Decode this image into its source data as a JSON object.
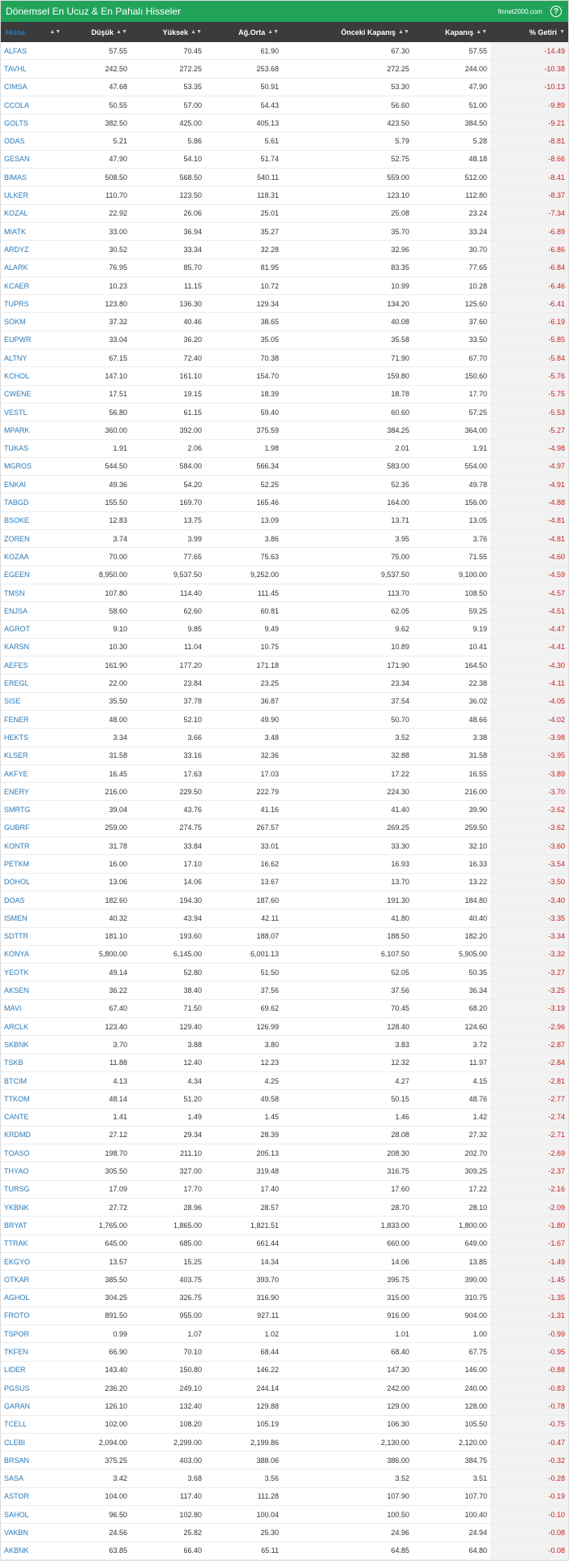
{
  "header": {
    "title": "Dönemsel En Ucuz & En Pahalı Hisseler",
    "brand": "finnet2000.com",
    "help": "?"
  },
  "columns": {
    "symbol": "Hisse",
    "low": "Düşük",
    "high": "Yüksek",
    "avg": "Ağ.Orta",
    "prev": "Önceki Kapanış",
    "close": "Kapanış",
    "ret": "% Getiri"
  },
  "colors": {
    "accent": "#21a45a",
    "header_bg": "#3b3b3b",
    "link": "#2a7ab8",
    "negative": "#cc2020"
  },
  "rows": [
    [
      "ALFAS",
      "57.55",
      "70.45",
      "61.90",
      "67.30",
      "57.55",
      "-14.49"
    ],
    [
      "TAVHL",
      "242.50",
      "272.25",
      "253.68",
      "272.25",
      "244.00",
      "-10.38"
    ],
    [
      "CIMSA",
      "47.68",
      "53.35",
      "50.91",
      "53.30",
      "47.90",
      "-10.13"
    ],
    [
      "CCOLA",
      "50.55",
      "57.00",
      "54.43",
      "56.60",
      "51.00",
      "-9.89"
    ],
    [
      "GOLTS",
      "382.50",
      "425.00",
      "405.13",
      "423.50",
      "384.50",
      "-9.21"
    ],
    [
      "ODAS",
      "5.21",
      "5.86",
      "5.61",
      "5.79",
      "5.28",
      "-8.81"
    ],
    [
      "GESAN",
      "47.90",
      "54.10",
      "51.74",
      "52.75",
      "48.18",
      "-8.66"
    ],
    [
      "BIMAS",
      "508.50",
      "568.50",
      "540.11",
      "559.00",
      "512.00",
      "-8.41"
    ],
    [
      "ULKER",
      "110.70",
      "123.50",
      "118.31",
      "123.10",
      "112.80",
      "-8.37"
    ],
    [
      "KOZAL",
      "22.92",
      "26.06",
      "25.01",
      "25.08",
      "23.24",
      "-7.34"
    ],
    [
      "MIATK",
      "33.00",
      "36.94",
      "35.27",
      "35.70",
      "33.24",
      "-6.89"
    ],
    [
      "ARDYZ",
      "30.52",
      "33.34",
      "32.28",
      "32.96",
      "30.70",
      "-6.86"
    ],
    [
      "ALARK",
      "76.95",
      "85.70",
      "81.95",
      "83.35",
      "77.65",
      "-6.84"
    ],
    [
      "KCAER",
      "10.23",
      "11.15",
      "10.72",
      "10.99",
      "10.28",
      "-6.46"
    ],
    [
      "TUPRS",
      "123.80",
      "136.30",
      "129.34",
      "134.20",
      "125.60",
      "-6.41"
    ],
    [
      "SOKM",
      "37.32",
      "40.46",
      "38.65",
      "40.08",
      "37.60",
      "-6.19"
    ],
    [
      "EUPWR",
      "33.04",
      "36.20",
      "35.05",
      "35.58",
      "33.50",
      "-5.85"
    ],
    [
      "ALTNY",
      "67.15",
      "72.40",
      "70.38",
      "71.90",
      "67.70",
      "-5.84"
    ],
    [
      "KCHOL",
      "147.10",
      "161.10",
      "154.70",
      "159.80",
      "150.60",
      "-5.76"
    ],
    [
      "CWENE",
      "17.51",
      "19.15",
      "18.39",
      "18.78",
      "17.70",
      "-5.75"
    ],
    [
      "VESTL",
      "56.80",
      "61.15",
      "59.40",
      "60.60",
      "57.25",
      "-5.53"
    ],
    [
      "MPARK",
      "360.00",
      "392.00",
      "375.59",
      "384.25",
      "364.00",
      "-5.27"
    ],
    [
      "TUKAS",
      "1.91",
      "2.06",
      "1.98",
      "2.01",
      "1.91",
      "-4.98"
    ],
    [
      "MGROS",
      "544.50",
      "584.00",
      "566.34",
      "583.00",
      "554.00",
      "-4.97"
    ],
    [
      "ENKAI",
      "49.36",
      "54.20",
      "52.25",
      "52.35",
      "49.78",
      "-4.91"
    ],
    [
      "TABGD",
      "155.50",
      "169.70",
      "165.46",
      "164.00",
      "156.00",
      "-4.88"
    ],
    [
      "BSOKE",
      "12.83",
      "13.75",
      "13.09",
      "13.71",
      "13.05",
      "-4.81"
    ],
    [
      "ZOREN",
      "3.74",
      "3.99",
      "3.86",
      "3.95",
      "3.76",
      "-4.81"
    ],
    [
      "KOZAA",
      "70.00",
      "77.65",
      "75.63",
      "75.00",
      "71.55",
      "-4.60"
    ],
    [
      "EGEEN",
      "8,950.00",
      "9,537.50",
      "9,252.00",
      "9,537.50",
      "9,100.00",
      "-4.59"
    ],
    [
      "TMSN",
      "107.80",
      "114.40",
      "111.45",
      "113.70",
      "108.50",
      "-4.57"
    ],
    [
      "ENJSA",
      "58.60",
      "62.60",
      "60.81",
      "62.05",
      "59.25",
      "-4.51"
    ],
    [
      "AGROT",
      "9.10",
      "9.85",
      "9.49",
      "9.62",
      "9.19",
      "-4.47"
    ],
    [
      "KARSN",
      "10.30",
      "11.04",
      "10.75",
      "10.89",
      "10.41",
      "-4.41"
    ],
    [
      "AEFES",
      "161.90",
      "177.20",
      "171.18",
      "171.90",
      "164.50",
      "-4.30"
    ],
    [
      "EREGL",
      "22.00",
      "23.84",
      "23.25",
      "23.34",
      "22.38",
      "-4.11"
    ],
    [
      "SISE",
      "35.50",
      "37.78",
      "36.87",
      "37.54",
      "36.02",
      "-4.05"
    ],
    [
      "FENER",
      "48.00",
      "52.10",
      "49.90",
      "50.70",
      "48.66",
      "-4.02"
    ],
    [
      "HEKTS",
      "3.34",
      "3.66",
      "3.48",
      "3.52",
      "3.38",
      "-3.98"
    ],
    [
      "KLSER",
      "31.58",
      "33.16",
      "32.36",
      "32.88",
      "31.58",
      "-3.95"
    ],
    [
      "AKFYE",
      "16.45",
      "17.63",
      "17.03",
      "17.22",
      "16.55",
      "-3.89"
    ],
    [
      "ENERY",
      "216.00",
      "229.50",
      "222.79",
      "224.30",
      "216.00",
      "-3.70"
    ],
    [
      "SMRTG",
      "39.04",
      "43.76",
      "41.16",
      "41.40",
      "39.90",
      "-3.62"
    ],
    [
      "GUBRF",
      "259.00",
      "274.75",
      "267.57",
      "269.25",
      "259.50",
      "-3.62"
    ],
    [
      "KONTR",
      "31.78",
      "33.84",
      "33.01",
      "33.30",
      "32.10",
      "-3.60"
    ],
    [
      "PETKM",
      "16.00",
      "17.10",
      "16.62",
      "16.93",
      "16.33",
      "-3.54"
    ],
    [
      "DOHOL",
      "13.06",
      "14.06",
      "13.67",
      "13.70",
      "13.22",
      "-3.50"
    ],
    [
      "DOAS",
      "182.60",
      "194.30",
      "187.60",
      "191.30",
      "184.80",
      "-3.40"
    ],
    [
      "ISMEN",
      "40.32",
      "43.94",
      "42.11",
      "41.80",
      "40.40",
      "-3.35"
    ],
    [
      "SDTTR",
      "181.10",
      "193.60",
      "188.07",
      "188.50",
      "182.20",
      "-3.34"
    ],
    [
      "KONYA",
      "5,800.00",
      "6,145.00",
      "6,001.13",
      "6,107.50",
      "5,905.00",
      "-3.32"
    ],
    [
      "YEOTK",
      "49.14",
      "52.80",
      "51.50",
      "52.05",
      "50.35",
      "-3.27"
    ],
    [
      "AKSEN",
      "36.22",
      "38.40",
      "37.56",
      "37.56",
      "36.34",
      "-3.25"
    ],
    [
      "MAVI",
      "67.40",
      "71.50",
      "69.62",
      "70.45",
      "68.20",
      "-3.19"
    ],
    [
      "ARCLK",
      "123.40",
      "129.40",
      "126.99",
      "128.40",
      "124.60",
      "-2.96"
    ],
    [
      "SKBNK",
      "3.70",
      "3.88",
      "3.80",
      "3.83",
      "3.72",
      "-2.87"
    ],
    [
      "TSKB",
      "11.88",
      "12.40",
      "12.23",
      "12.32",
      "11.97",
      "-2.84"
    ],
    [
      "BTCIM",
      "4.13",
      "4.34",
      "4.25",
      "4.27",
      "4.15",
      "-2.81"
    ],
    [
      "TTKOM",
      "48.14",
      "51.20",
      "49.58",
      "50.15",
      "48.76",
      "-2.77"
    ],
    [
      "CANTE",
      "1.41",
      "1.49",
      "1.45",
      "1.46",
      "1.42",
      "-2.74"
    ],
    [
      "KRDMD",
      "27.12",
      "29.34",
      "28.39",
      "28.08",
      "27.32",
      "-2.71"
    ],
    [
      "TOASO",
      "198.70",
      "211.10",
      "205.13",
      "208.30",
      "202.70",
      "-2.69"
    ],
    [
      "THYAO",
      "305.50",
      "327.00",
      "319.48",
      "316.75",
      "309.25",
      "-2.37"
    ],
    [
      "TURSG",
      "17.09",
      "17.70",
      "17.40",
      "17.60",
      "17.22",
      "-2.16"
    ],
    [
      "YKBNK",
      "27.72",
      "28.96",
      "28.57",
      "28.70",
      "28.10",
      "-2.09"
    ],
    [
      "BRYAT",
      "1,765.00",
      "1,865.00",
      "1,821.51",
      "1,833.00",
      "1,800.00",
      "-1.80"
    ],
    [
      "TTRAK",
      "645.00",
      "685.00",
      "661.44",
      "660.00",
      "649.00",
      "-1.67"
    ],
    [
      "EKGYO",
      "13.57",
      "15.25",
      "14.34",
      "14.06",
      "13.85",
      "-1.49"
    ],
    [
      "OTKAR",
      "385.50",
      "403.75",
      "393.70",
      "395.75",
      "390.00",
      "-1.45"
    ],
    [
      "AGHOL",
      "304.25",
      "326.75",
      "316.90",
      "315.00",
      "310.75",
      "-1.35"
    ],
    [
      "FROTO",
      "891.50",
      "955.00",
      "927.11",
      "916.00",
      "904.00",
      "-1.31"
    ],
    [
      "TSPOR",
      "0.99",
      "1.07",
      "1.02",
      "1.01",
      "1.00",
      "-0.99"
    ],
    [
      "TKFEN",
      "66.90",
      "70.10",
      "68.44",
      "68.40",
      "67.75",
      "-0.95"
    ],
    [
      "LIDER",
      "143.40",
      "150.80",
      "146.22",
      "147.30",
      "146.00",
      "-0.88"
    ],
    [
      "PGSUS",
      "236.20",
      "249.10",
      "244.14",
      "242.00",
      "240.00",
      "-0.83"
    ],
    [
      "GARAN",
      "126.10",
      "132.40",
      "129.88",
      "129.00",
      "128.00",
      "-0.78"
    ],
    [
      "TCELL",
      "102.00",
      "108.20",
      "105.19",
      "106.30",
      "105.50",
      "-0.75"
    ],
    [
      "CLEBI",
      "2,094.00",
      "2,299.00",
      "2,199.86",
      "2,130.00",
      "2,120.00",
      "-0.47"
    ],
    [
      "BRSAN",
      "375.25",
      "403.00",
      "388.06",
      "386.00",
      "384.75",
      "-0.32"
    ],
    [
      "SASA",
      "3.42",
      "3.68",
      "3.56",
      "3.52",
      "3.51",
      "-0.28"
    ],
    [
      "ASTOR",
      "104.00",
      "117.40",
      "111.28",
      "107.90",
      "107.70",
      "-0.19"
    ],
    [
      "SAHOL",
      "96.50",
      "102.80",
      "100.04",
      "100.50",
      "100.40",
      "-0.10"
    ],
    [
      "VAKBN",
      "24.56",
      "25.82",
      "25.30",
      "24.96",
      "24.94",
      "-0.08"
    ],
    [
      "AKBNK",
      "63.85",
      "66.40",
      "65.11",
      "64.85",
      "64.80",
      "-0.08"
    ]
  ]
}
